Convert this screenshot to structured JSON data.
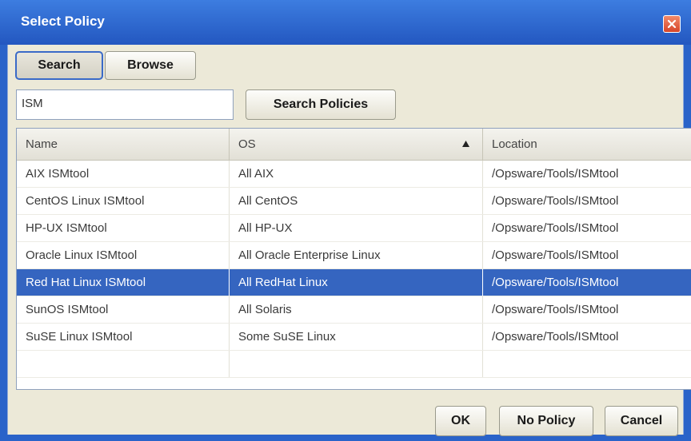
{
  "dialog": {
    "title": "Select Policy",
    "close_icon": "close-icon"
  },
  "tabs": [
    {
      "label": "Search",
      "active": true
    },
    {
      "label": "Browse",
      "active": false
    }
  ],
  "search": {
    "value": "ISM",
    "button_label": "Search Policies"
  },
  "table": {
    "columns": [
      "Name",
      "OS",
      "Location"
    ],
    "sorted_column": "OS",
    "sort_direction": "ascending",
    "rows": [
      {
        "name": "AIX ISMtool",
        "os": "All AIX",
        "location": "/Opsware/Tools/ISMtool"
      },
      {
        "name": "CentOS Linux ISMtool",
        "os": "All CentOS",
        "location": "/Opsware/Tools/ISMtool"
      },
      {
        "name": "HP-UX ISMtool",
        "os": "All HP-UX",
        "location": "/Opsware/Tools/ISMtool"
      },
      {
        "name": "Oracle Linux ISMtool",
        "os": "All Oracle Enterprise Linux",
        "location": "/Opsware/Tools/ISMtool"
      },
      {
        "name": "Red Hat Linux ISMtool",
        "os": "All RedHat Linux",
        "location": "/Opsware/Tools/ISMtool"
      },
      {
        "name": "SunOS ISMtool",
        "os": "All Solaris",
        "location": "/Opsware/Tools/ISMtool"
      },
      {
        "name": "SuSE Linux ISMtool",
        "os": "Some SuSE Linux",
        "location": "/Opsware/Tools/ISMtool"
      }
    ],
    "selected_row": "Red Hat Linux ISMtool"
  },
  "footer": {
    "ok_label": "OK",
    "no_policy_label": "No Policy",
    "cancel_label": "Cancel"
  },
  "colors": {
    "titlebar": "#2a63c9",
    "selection": "#3565c0",
    "panel": "#ece9d8"
  }
}
